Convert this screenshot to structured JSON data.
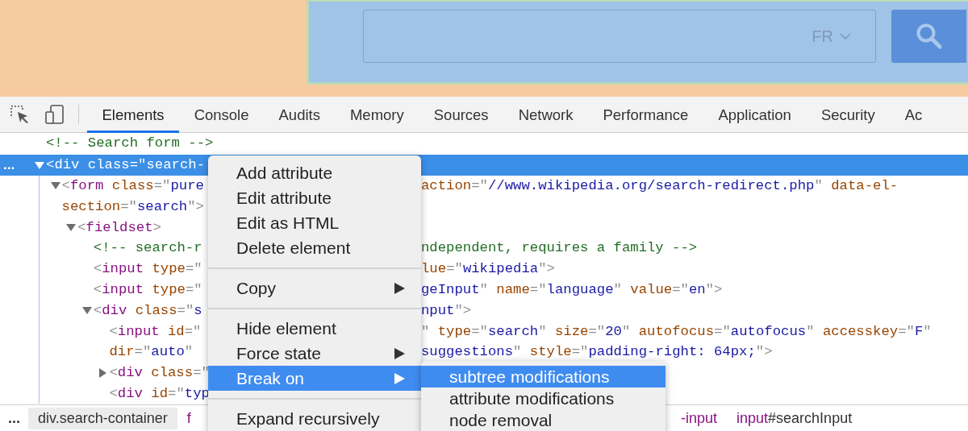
{
  "page": {
    "search": {
      "language": "FR"
    }
  },
  "devtools": {
    "tabs": [
      {
        "label": "Elements",
        "selected": true
      },
      {
        "label": "Console",
        "selected": false
      },
      {
        "label": "Audits",
        "selected": false
      },
      {
        "label": "Memory",
        "selected": false
      },
      {
        "label": "Sources",
        "selected": false
      },
      {
        "label": "Network",
        "selected": false
      },
      {
        "label": "Performance",
        "selected": false
      },
      {
        "label": "Application",
        "selected": false
      },
      {
        "label": "Security",
        "selected": false
      },
      {
        "label": "Ac",
        "selected": false
      }
    ],
    "tree": [
      {
        "kind": "leaf",
        "selected": false,
        "left": [
          {
            "kind": "comment",
            "text": "<!-- Search form -->"
          }
        ]
      },
      {
        "kind": "parent",
        "expanded": true,
        "selected": true,
        "more": "...",
        "left": [
          {
            "kind": "punct",
            "text": "<"
          },
          {
            "kind": "tag",
            "text": "div"
          },
          {
            "kind": "attr",
            "text": " class"
          },
          {
            "kind": "punct",
            "text": "=\""
          },
          {
            "kind": "value",
            "text": "search-"
          }
        ],
        "children": [
          {
            "kind": "parent",
            "expanded": true,
            "selected": false,
            "left": [
              {
                "kind": "punct",
                "text": "<"
              },
              {
                "kind": "tag",
                "text": "form"
              },
              {
                "kind": "attr",
                "text": " class"
              },
              {
                "kind": "punct",
                "text": "=\""
              },
              {
                "kind": "value",
                "text": "pure"
              }
            ],
            "right": [
              {
                "kind": "attr",
                "text": "action"
              },
              {
                "kind": "punct",
                "text": "=\""
              },
              {
                "kind": "value",
                "text": "//www.wikipedia.org/search-redirect.php"
              },
              {
                "kind": "punct",
                "text": "\""
              },
              {
                "kind": "attr",
                "text": " data-el-"
              }
            ],
            "wrap": [
              {
                "left": [
                  {
                    "kind": "attr",
                    "text": "section"
                  },
                  {
                    "kind": "punct",
                    "text": "=\""
                  },
                  {
                    "kind": "value",
                    "text": "search"
                  },
                  {
                    "kind": "punct",
                    "text": "\">"
                  }
                ]
              }
            ],
            "children": [
              {
                "kind": "parent",
                "expanded": true,
                "selected": false,
                "left": [
                  {
                    "kind": "punct",
                    "text": "<"
                  },
                  {
                    "kind": "tag",
                    "text": "fieldset"
                  },
                  {
                    "kind": "punct",
                    "text": ">"
                  }
                ],
                "children": [
                  {
                    "kind": "leaf",
                    "selected": false,
                    "left": [
                      {
                        "kind": "comment",
                        "text": "<!-- search-r"
                      }
                    ],
                    "right": [
                      {
                        "kind": "comment",
                        "text": "ndependent, requires a family -->"
                      }
                    ]
                  },
                  {
                    "kind": "leaf",
                    "selected": false,
                    "left": [
                      {
                        "kind": "punct",
                        "text": "<"
                      },
                      {
                        "kind": "tag",
                        "text": "input"
                      },
                      {
                        "kind": "attr",
                        "text": " type"
                      },
                      {
                        "kind": "punct",
                        "text": "=\""
                      }
                    ],
                    "right": [
                      {
                        "kind": "attr",
                        "text": "lue"
                      },
                      {
                        "kind": "punct",
                        "text": "=\""
                      },
                      {
                        "kind": "value",
                        "text": "wikipedia"
                      },
                      {
                        "kind": "punct",
                        "text": "\">"
                      }
                    ]
                  },
                  {
                    "kind": "leaf",
                    "selected": false,
                    "left": [
                      {
                        "kind": "punct",
                        "text": "<"
                      },
                      {
                        "kind": "tag",
                        "text": "input"
                      },
                      {
                        "kind": "attr",
                        "text": " type"
                      },
                      {
                        "kind": "punct",
                        "text": "=\""
                      }
                    ],
                    "right": [
                      {
                        "kind": "value",
                        "text": "geInput"
                      },
                      {
                        "kind": "punct",
                        "text": "\""
                      },
                      {
                        "kind": "attr",
                        "text": " name"
                      },
                      {
                        "kind": "punct",
                        "text": "=\""
                      },
                      {
                        "kind": "value",
                        "text": "language"
                      },
                      {
                        "kind": "punct",
                        "text": "\""
                      },
                      {
                        "kind": "attr",
                        "text": " value"
                      },
                      {
                        "kind": "punct",
                        "text": "=\""
                      },
                      {
                        "kind": "value",
                        "text": "en"
                      },
                      {
                        "kind": "punct",
                        "text": "\">"
                      }
                    ]
                  },
                  {
                    "kind": "parent",
                    "expanded": true,
                    "selected": false,
                    "left": [
                      {
                        "kind": "punct",
                        "text": "<"
                      },
                      {
                        "kind": "tag",
                        "text": "div"
                      },
                      {
                        "kind": "attr",
                        "text": " class"
                      },
                      {
                        "kind": "punct",
                        "text": "=\""
                      },
                      {
                        "kind": "value",
                        "text": "s"
                      }
                    ],
                    "right": [
                      {
                        "kind": "value",
                        "text": "nput"
                      },
                      {
                        "kind": "punct",
                        "text": "\">"
                      }
                    ],
                    "children": [
                      {
                        "kind": "leaf",
                        "selected": false,
                        "left": [
                          {
                            "kind": "punct",
                            "text": "<"
                          },
                          {
                            "kind": "tag",
                            "text": "input"
                          },
                          {
                            "kind": "attr",
                            "text": " id"
                          },
                          {
                            "kind": "punct",
                            "text": "=\""
                          }
                        ],
                        "right": [
                          {
                            "kind": "punct",
                            "text": "\""
                          },
                          {
                            "kind": "attr",
                            "text": " type"
                          },
                          {
                            "kind": "punct",
                            "text": "=\""
                          },
                          {
                            "kind": "value",
                            "text": "search"
                          },
                          {
                            "kind": "punct",
                            "text": "\""
                          },
                          {
                            "kind": "attr",
                            "text": " size"
                          },
                          {
                            "kind": "punct",
                            "text": "=\""
                          },
                          {
                            "kind": "value",
                            "text": "20"
                          },
                          {
                            "kind": "punct",
                            "text": "\""
                          },
                          {
                            "kind": "attr",
                            "text": " autofocus"
                          },
                          {
                            "kind": "punct",
                            "text": "=\""
                          },
                          {
                            "kind": "value",
                            "text": "autofocus"
                          },
                          {
                            "kind": "punct",
                            "text": "\""
                          },
                          {
                            "kind": "attr",
                            "text": " accesskey"
                          },
                          {
                            "kind": "punct",
                            "text": "=\""
                          },
                          {
                            "kind": "value",
                            "text": "F"
                          },
                          {
                            "kind": "punct",
                            "text": "\""
                          }
                        ],
                        "wrap": [
                          {
                            "left": [
                              {
                                "kind": "attr",
                                "text": "dir"
                              },
                              {
                                "kind": "punct",
                                "text": "=\""
                              },
                              {
                                "kind": "value",
                                "text": "auto"
                              },
                              {
                                "kind": "punct",
                                "text": "\""
                              }
                            ],
                            "right": [
                              {
                                "kind": "value",
                                "text": "suggestions"
                              },
                              {
                                "kind": "punct",
                                "text": "\""
                              },
                              {
                                "kind": "attr",
                                "text": " style"
                              },
                              {
                                "kind": "punct",
                                "text": "=\""
                              },
                              {
                                "kind": "value",
                                "text": "padding-right: 64px;"
                              },
                              {
                                "kind": "punct",
                                "text": "\">"
                              }
                            ]
                          }
                        ]
                      },
                      {
                        "kind": "parent",
                        "expanded": false,
                        "selected": false,
                        "left": [
                          {
                            "kind": "punct",
                            "text": "<"
                          },
                          {
                            "kind": "tag",
                            "text": "div"
                          },
                          {
                            "kind": "attr",
                            "text": " class"
                          },
                          {
                            "kind": "punct",
                            "text": "=\""
                          }
                        ]
                      },
                      {
                        "kind": "leaf",
                        "selected": false,
                        "left": [
                          {
                            "kind": "punct",
                            "text": "<"
                          },
                          {
                            "kind": "tag",
                            "text": "div"
                          },
                          {
                            "kind": "attr",
                            "text": " id"
                          },
                          {
                            "kind": "punct",
                            "text": "=\""
                          },
                          {
                            "kind": "value",
                            "text": "typ"
                          }
                        ]
                      }
                    ]
                  }
                ]
              }
            ]
          }
        ]
      }
    ],
    "breadcrumbs": {
      "more": "...",
      "left": [
        {
          "tag": "div",
          "rest": ".search-container",
          "selected": true
        },
        {
          "tag": "f",
          "selected": false
        }
      ],
      "right": [
        {
          "tag": "-input",
          "selected": false
        },
        {
          "tag": "input",
          "rest": "#searchInput",
          "selected": false
        }
      ]
    },
    "context_menu": {
      "items": [
        {
          "kind": "item",
          "label": "Add attribute",
          "submenu": false,
          "selected": false
        },
        {
          "kind": "item",
          "label": "Edit attribute",
          "submenu": false,
          "selected": false
        },
        {
          "kind": "item",
          "label": "Edit as HTML",
          "submenu": false,
          "selected": false
        },
        {
          "kind": "item",
          "label": "Delete element",
          "submenu": false,
          "selected": false
        },
        {
          "kind": "separator"
        },
        {
          "kind": "item",
          "label": "Copy",
          "submenu": true,
          "selected": false
        },
        {
          "kind": "separator"
        },
        {
          "kind": "item",
          "label": "Hide element",
          "submenu": false,
          "selected": false
        },
        {
          "kind": "item",
          "label": "Force state",
          "submenu": true,
          "selected": false
        },
        {
          "kind": "item",
          "label": "Break on",
          "submenu": true,
          "selected": true
        },
        {
          "kind": "separator"
        },
        {
          "kind": "item",
          "label": "Expand recursively",
          "submenu": false,
          "selected": false
        }
      ]
    },
    "submenu": {
      "items": [
        {
          "kind": "item",
          "label": "subtree modifications",
          "selected": true
        },
        {
          "kind": "item",
          "label": "attribute modifications",
          "selected": false
        },
        {
          "kind": "item",
          "label": "node removal",
          "selected": false
        }
      ]
    }
  }
}
